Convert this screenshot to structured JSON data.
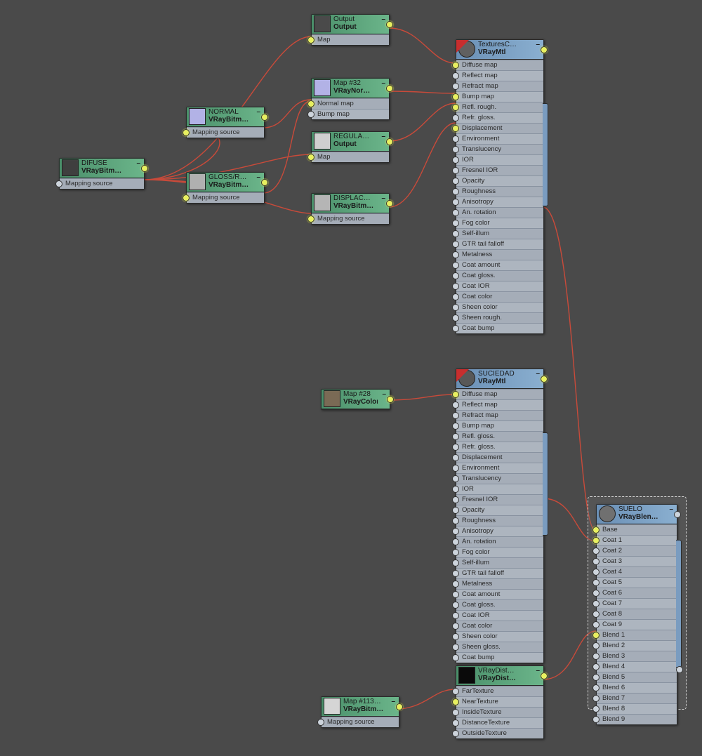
{
  "collapse_glyph": "–",
  "nodes": {
    "difuse": {
      "title": "DIFUSE",
      "sub": "VRayBitm…",
      "slots": [
        "Mapping source"
      ]
    },
    "normal": {
      "title": "NORMAL",
      "sub": "VRayBitm…",
      "slots": [
        "Mapping source"
      ]
    },
    "glossr": {
      "title": "GLOSS/R…",
      "sub": "VRayBitm…",
      "slots": [
        "Mapping source"
      ]
    },
    "output": {
      "title": "Output",
      "sub": "Output",
      "slots": [
        "Map"
      ]
    },
    "map32": {
      "title": "Map #32",
      "sub": "VRayNor…",
      "slots": [
        "Normal map",
        "Bump map"
      ]
    },
    "regula": {
      "title": "REGULA…",
      "sub": "Output",
      "slots": [
        "Map"
      ]
    },
    "displac": {
      "title": "DISPLAC…",
      "sub": "VRayBitm…",
      "slots": [
        "Mapping source"
      ]
    },
    "map28": {
      "title": "Map #28",
      "sub": "VRayColor"
    },
    "map113": {
      "title": "Map #113…",
      "sub": "VRayBitm…",
      "slots": [
        "Mapping source"
      ]
    },
    "vraydist": {
      "title": "VRayDist…",
      "sub": "VRayDist…",
      "slots": [
        "FarTexture",
        "NearTexture",
        "InsideTexture",
        "DistanceTexture",
        "OutsideTexture"
      ]
    },
    "texturesc": {
      "title": "TexturesC…",
      "sub": "VRayMtl",
      "slots": [
        "Diffuse map",
        "Reflect map",
        "Refract map",
        "Bump map",
        "Refl. rough.",
        "Refr. gloss.",
        "Displacement",
        "Environment",
        "Translucency",
        "IOR",
        "Fresnel IOR",
        "Opacity",
        "Roughness",
        "Anisotropy",
        "An. rotation",
        "Fog color",
        "Self-illum",
        "GTR tail falloff",
        "Metalness",
        "Coat amount",
        "Coat gloss.",
        "Coat IOR",
        "Coat color",
        "Sheen color",
        "Sheen rough.",
        "Coat bump"
      ]
    },
    "suciedad": {
      "title": "SUCIEDAD",
      "sub": "VRayMtl",
      "slots": [
        "Diffuse map",
        "Reflect map",
        "Refract map",
        "Bump map",
        "Refl. gloss.",
        "Refr. gloss.",
        "Displacement",
        "Environment",
        "Translucency",
        "IOR",
        "Fresnel IOR",
        "Opacity",
        "Roughness",
        "Anisotropy",
        "An. rotation",
        "Fog color",
        "Self-illum",
        "GTR tail falloff",
        "Metalness",
        "Coat amount",
        "Coat gloss.",
        "Coat IOR",
        "Coat color",
        "Sheen color",
        "Sheen gloss.",
        "Coat bump"
      ]
    },
    "suelo": {
      "title": "SUELO",
      "sub": "VRayBlen…",
      "slots": [
        "Base",
        "Coat 1",
        "Coat 2",
        "Coat 3",
        "Coat 4",
        "Coat 5",
        "Coat 6",
        "Coat 7",
        "Coat 8",
        "Coat 9",
        "Blend 1",
        "Blend 2",
        "Blend 3",
        "Blend 4",
        "Blend 5",
        "Blend 6",
        "Blend 7",
        "Blend 8",
        "Blend 9"
      ]
    }
  },
  "thumb_colors": {
    "difuse": "#3f3f3f",
    "normal": "#b2b2e6",
    "glossr": "#b0b0b0",
    "output": "#4a4a4a",
    "map32": "#b2b2e6",
    "regula": "#cfcfcf",
    "displac": "#b5b5b5",
    "map28": "#7a6a55",
    "map113": "#d5d5d5",
    "vraydist": "#0a0a0a",
    "texturesc": "#606060",
    "suciedad": "#585858",
    "suelo": "#707070"
  }
}
